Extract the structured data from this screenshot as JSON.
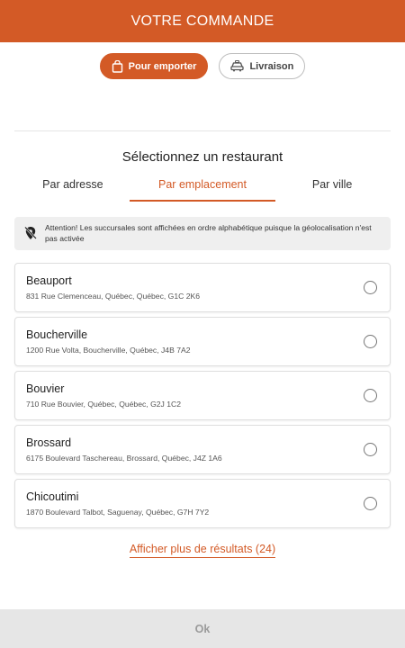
{
  "header": {
    "title": "VOTRE COMMANDE"
  },
  "mode": {
    "takeout_label": "Pour emporter",
    "delivery_label": "Livraison",
    "selected": "takeout"
  },
  "section": {
    "title": "Sélectionnez un restaurant"
  },
  "tabs": [
    {
      "label": "Par adresse"
    },
    {
      "label": "Par emplacement"
    },
    {
      "label": "Par ville"
    }
  ],
  "notice": {
    "text": "Attention! Les succursales sont affichées en ordre alphabétique puisque la géolocalisation n'est pas activée"
  },
  "restaurants": [
    {
      "name": "Beauport",
      "address": "831 Rue Clemenceau, Québec, Québec, G1C 2K6"
    },
    {
      "name": "Boucherville",
      "address": "1200 Rue Volta, Boucherville, Québec, J4B 7A2"
    },
    {
      "name": "Bouvier",
      "address": "710 Rue Bouvier, Québec, Québec, G2J 1C2"
    },
    {
      "name": "Brossard",
      "address": "6175 Boulevard Taschereau, Brossard, Québec, J4Z 1A6"
    },
    {
      "name": "Chicoutimi",
      "address": "1870 Boulevard Talbot, Saguenay, Québec, G7H 7Y2"
    }
  ],
  "more": {
    "label": "Afficher plus de résultats (24)"
  },
  "footer": {
    "ok_label": "Ok"
  },
  "colors": {
    "accent": "#d35a26",
    "footer_bg": "#e6e6e6",
    "notice_bg": "#efefef"
  }
}
